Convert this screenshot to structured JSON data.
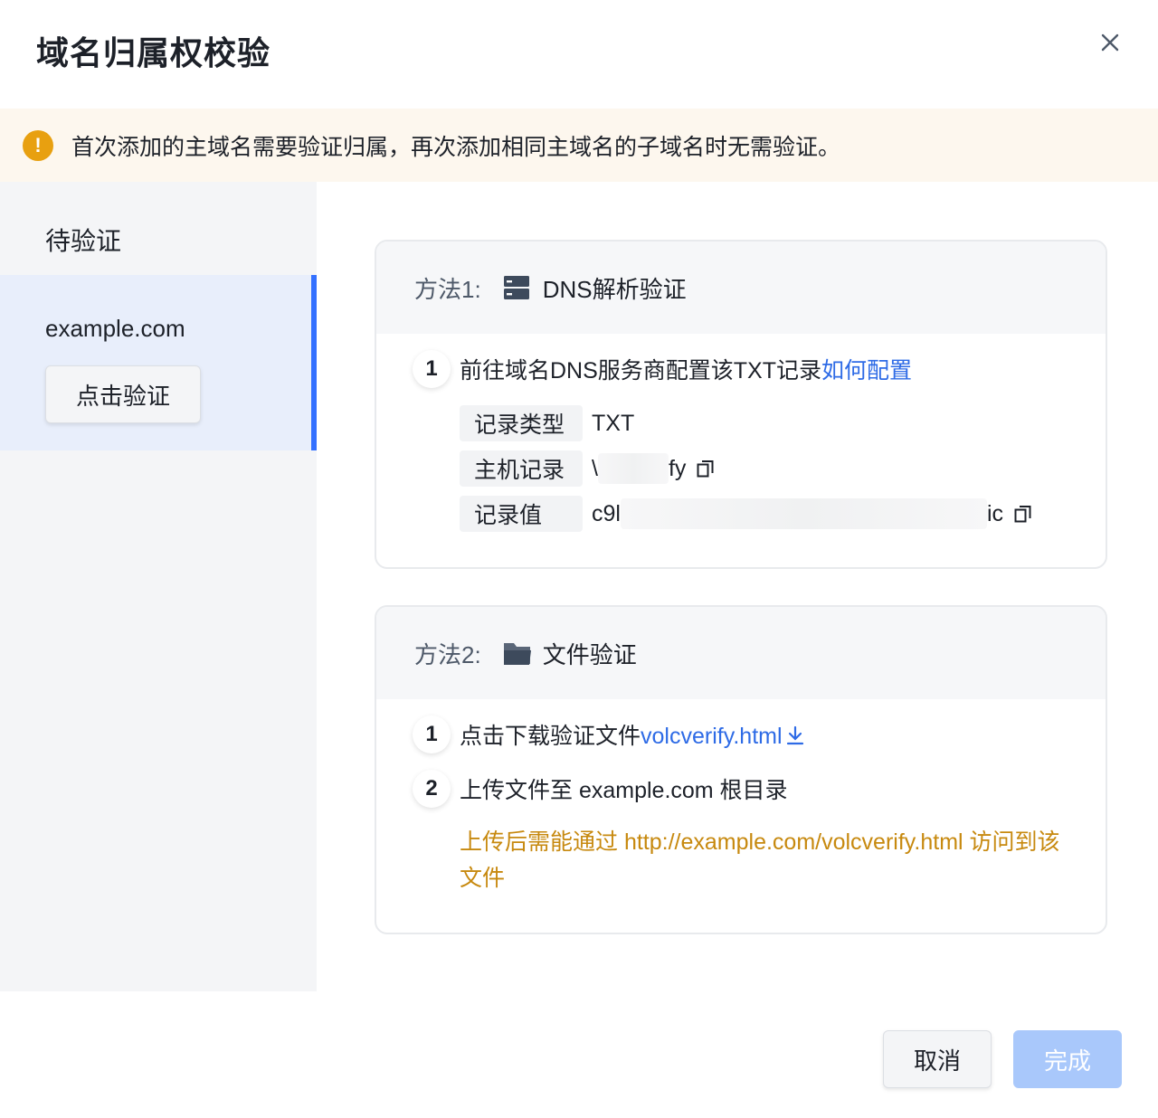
{
  "dialog": {
    "title": "域名归属权校验",
    "close_icon": "close-icon"
  },
  "alert": {
    "icon": "warning-icon",
    "text": "首次添加的主域名需要验证归属，再次添加相同主域名的子域名时无需验证。"
  },
  "sidebar": {
    "heading": "待验证",
    "items": [
      {
        "domain": "example.com",
        "button_label": "点击验证"
      }
    ]
  },
  "method1": {
    "label": "方法1:",
    "icon": "server-icon",
    "title": "DNS解析验证",
    "step1": {
      "num": "1",
      "text": "前往域名DNS服务商配置该TXT记录",
      "link": "如何配置"
    },
    "records": [
      {
        "key": "记录类型",
        "value_start": "TXT",
        "value_end": ""
      },
      {
        "key": "主机记录",
        "value_start": "\\",
        "value_end": "fy"
      },
      {
        "key": "记录值",
        "value_start": "c9l",
        "value_end": "ic"
      }
    ]
  },
  "method2": {
    "label": "方法2:",
    "icon": "folder-icon",
    "title": "文件验证",
    "step1": {
      "num": "1",
      "text": "点击下载验证文件",
      "link": "volcverify.html"
    },
    "step2": {
      "num": "2",
      "text": "上传文件至 example.com 根目录"
    },
    "note": "上传后需能通过 http://example.com/volcverify.html 访问到该文件"
  },
  "footer": {
    "cancel_label": "取消",
    "done_label": "完成"
  },
  "colors": {
    "accent": "#3370ff",
    "link": "#2e6be6",
    "warning": "#e8a010",
    "note": "#c7890f",
    "done_disabled": "#a9c8fb"
  }
}
